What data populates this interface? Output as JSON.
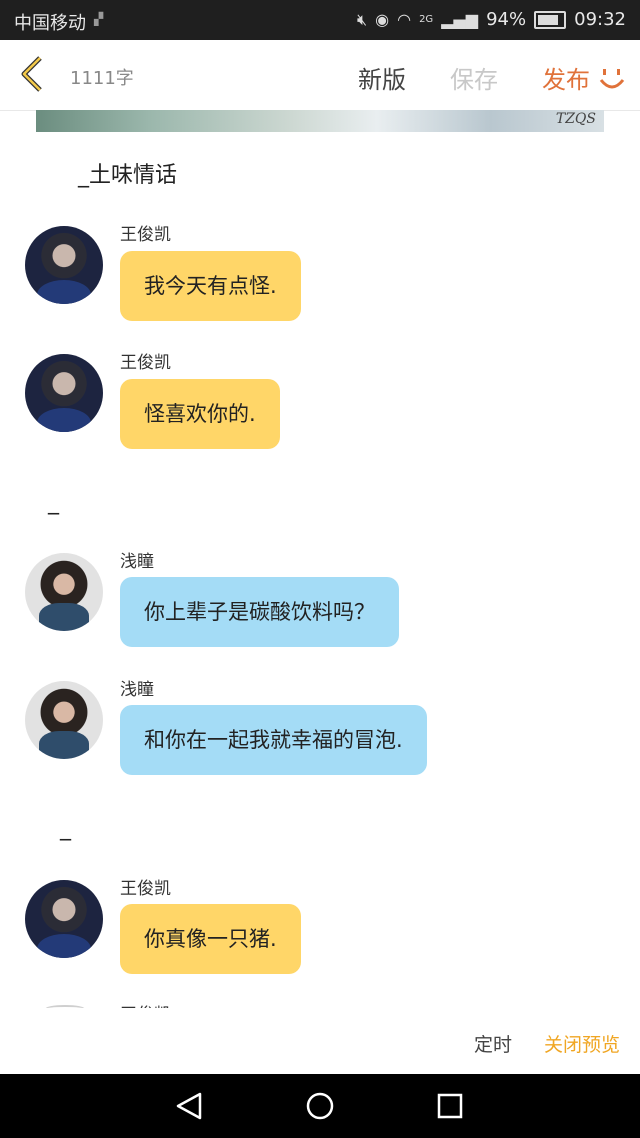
{
  "status_bar": {
    "carrier": "中国移动",
    "network": "2G",
    "battery": "94%",
    "time": "09:32"
  },
  "header": {
    "word_count": "1111字",
    "new_version": "新版",
    "save": "保存",
    "publish": "发布"
  },
  "banner": {
    "watermark": "TZQS"
  },
  "story": {
    "title": "_土味情话",
    "separators": [
      "_",
      "_"
    ],
    "messages": [
      {
        "sender": "王俊凯",
        "text": "我今天有点怪.",
        "color": "#ffd668"
      },
      {
        "sender": "王俊凯",
        "text": "怪喜欢你的.",
        "color": "#ffd668"
      },
      {
        "sender": "浅瞳",
        "text": "你上辈子是碳酸饮料吗？",
        "color": "#a4dcf6"
      },
      {
        "sender": "浅瞳",
        "text": "和你在一起我就幸福的冒泡.",
        "color": "#a4dcf6"
      },
      {
        "sender": "王俊凯",
        "text": "你真像一只猪.",
        "color": "#ffd668"
      },
      {
        "sender": "王俊凯"
      }
    ]
  },
  "footer": {
    "timer": "定时",
    "close_preview": "关闭预览"
  },
  "icons": {
    "back": "chevron-left-icon",
    "smile": "smile-icon",
    "nav_back": "triangle-back-icon",
    "nav_home": "circle-home-icon",
    "nav_recent": "square-recent-icon"
  },
  "colors": {
    "accent": "#f0a623",
    "publish": "#e0723a"
  }
}
